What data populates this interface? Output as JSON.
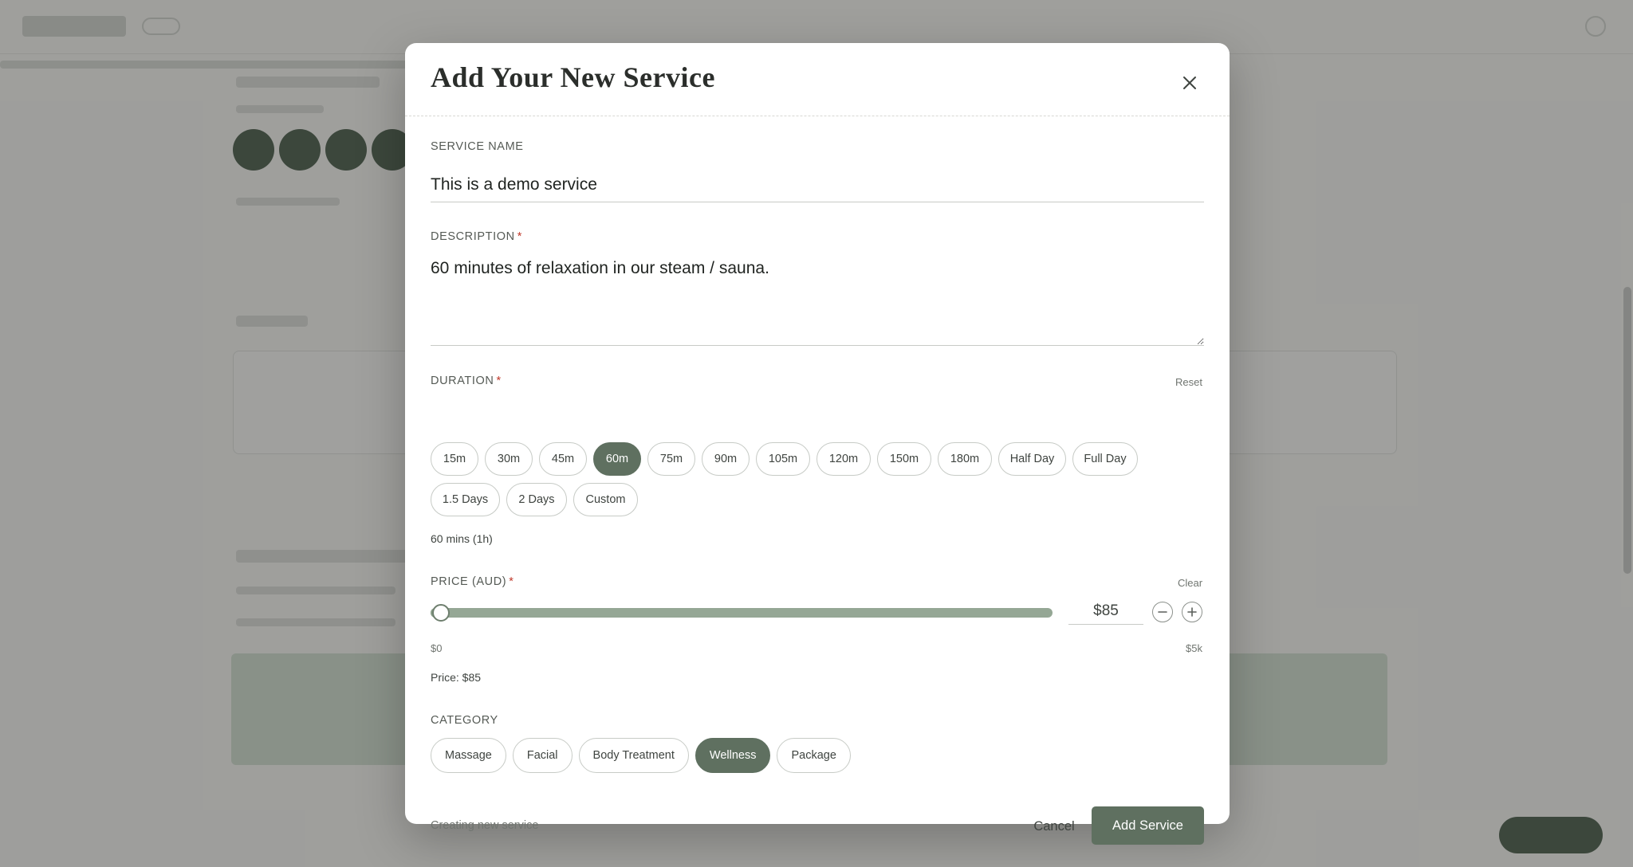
{
  "modal": {
    "title": "Add Your New Service",
    "close_icon": "close-icon"
  },
  "service_name": {
    "label": "SERVICE NAME",
    "value": "This is a demo service"
  },
  "description": {
    "label": "DESCRIPTION",
    "required_mark": "*",
    "value": "60 minutes of relaxation in our steam / sauna."
  },
  "duration": {
    "label": "DURATION",
    "required_mark": "*",
    "reset_label": "Reset",
    "options_row1": [
      "15m",
      "30m",
      "45m",
      "60m",
      "75m",
      "90m",
      "105m",
      "120m",
      "150m",
      "180m",
      "Half Day",
      "Full Day"
    ],
    "options_row2": [
      "1.5 Days",
      "2 Days",
      "Custom"
    ],
    "selected": "60m",
    "summary": "60 mins (1h)"
  },
  "price": {
    "label": "PRICE (AUD)",
    "required_mark": "*",
    "clear_label": "Clear",
    "value": "$85",
    "min_label": "$0",
    "max_label": "$5k",
    "slider_fraction": 0.017,
    "summary": "Price: $85",
    "minus_icon": "minus-icon",
    "plus_icon": "plus-icon"
  },
  "category": {
    "label": "CATEGORY",
    "options": [
      "Massage",
      "Facial",
      "Body Treatment",
      "Wellness",
      "Package"
    ],
    "selected": "Wellness"
  },
  "footer": {
    "status": "Creating new service",
    "cancel_label": "Cancel",
    "submit_label": "Add Service"
  },
  "colors": {
    "accent": "#5f7060",
    "slider": "#95a795",
    "required": "#c0392b"
  }
}
